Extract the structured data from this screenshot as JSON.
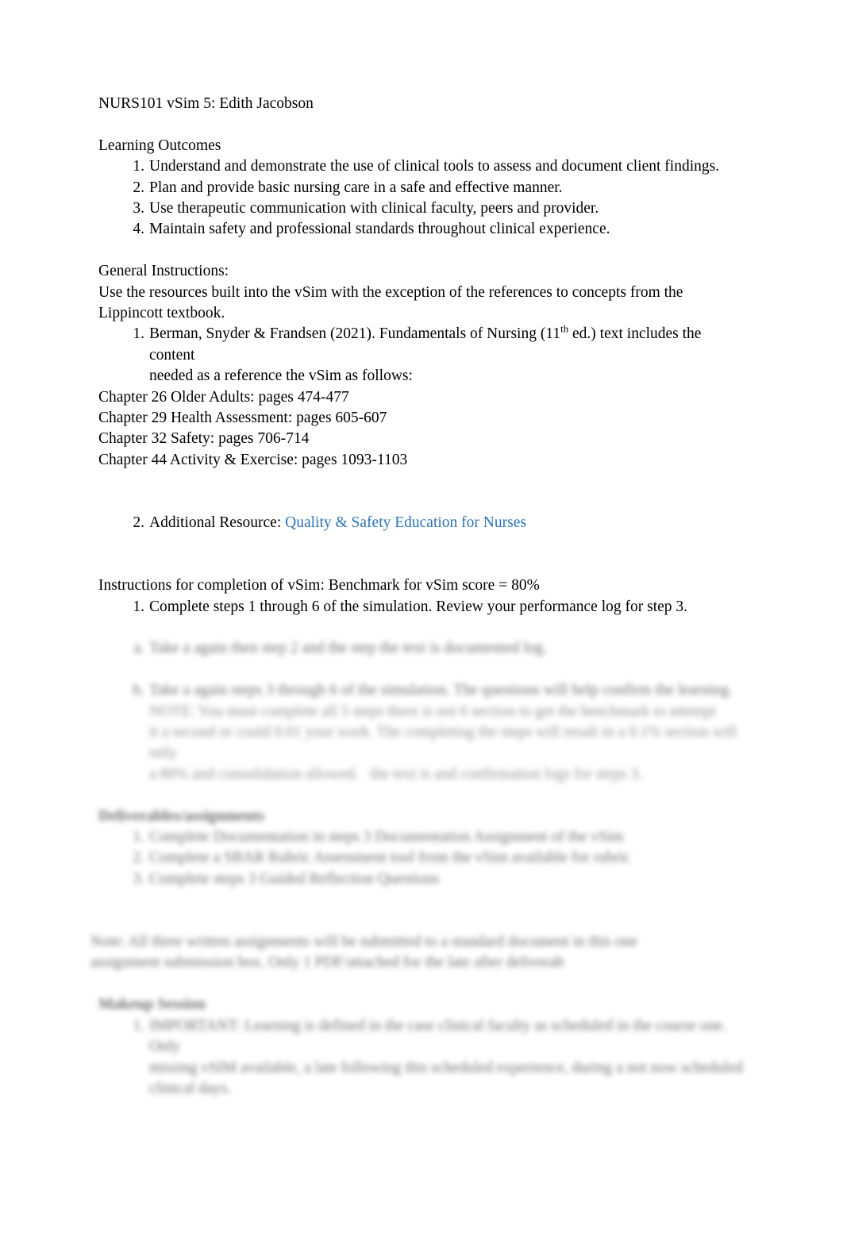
{
  "document": {
    "title": "NURS101 vSim 5: Edith Jacobson",
    "sections": {
      "learning_outcomes_heading": "Learning Outcomes",
      "learning_outcomes": [
        "Understand and demonstrate the use of clinical tools to assess and document client findings.",
        "Plan and provide basic nursing care in a safe and effective manner.",
        "Use therapeutic communication with clinical faculty, peers and provider.",
        "Maintain safety and professional standards throughout clinical experience."
      ],
      "general_instructions_heading": "General Instructions:",
      "general_instructions_body_line1": "Use the resources built into the vSim with the exception of the references to concepts from the",
      "general_instructions_body_line2": "Lippincott textbook.",
      "reference_item_part1": "Berman, Snyder & Frandsen (2021).",
      "reference_item_part2": "Fundamentals of Nursing (11",
      "reference_item_sup": "th",
      "reference_item_part3": " ed.) text includes the content",
      "reference_item_line2": "needed as a reference the vSim as follows:",
      "chapters": [
        "Chapter 26 Older Adults: pages 474-477",
        "Chapter 29 Health Assessment: pages 605-607",
        "Chapter 32 Safety: pages 706-714",
        "Chapter 44 Activity & Exercise: pages 1093-1103"
      ],
      "additional_resource_label": "Additional Resource: ",
      "additional_resource_link": "Quality & Safety Education for Nurses",
      "instructions_completion_part1": "Instructions for completion of vSim",
      "instructions_completion_part2": ": Benchmark for vSim score = 80%",
      "completion_steps": [
        "Complete steps 1 through 6 of the simulation. Review your performance log for step 3."
      ],
      "blurred": {
        "step_a": "Take a again then  step 2   and the step the text is documented log.",
        "step_b": "Take a again steps 3 through 6 of the simulation. The questions will help confirm the learning.",
        "note_line1": "NOTE: You must complete all 5 steps there is not 6 section to get the benchmark to attempt",
        "note_line2": "it a second or could 0.01 your work. The completing the steps will result in a 0.1% section will only",
        "note_line3": "a 80% and consolidation allowed.   the text is and confirmation logs for steps 3.",
        "deliverables_heading": "Deliverables/assignments",
        "deliverable_1": "Complete Documentation in steps 3   Documentation Assignment of the vSim",
        "deliverable_2": "Complete a SBAR Rubric Assessment tool from the vSim available for rubric",
        "deliverable_3": "Complete steps 3   Guided Reflection Questions",
        "para_line1": "Note: All three written assignments will be submitted to a standard document in this one",
        "para_line2": "assignment submission box. Only 1 PDF/attached for the late after deliverab",
        "makeup_heading": "Makeup Session",
        "makeup_line1": "IMPORTANT: Learning is defined in the case clinical faculty as scheduled in the course one. Only",
        "makeup_line2": "missing vSIM available, a late following this scheduled experience, during a not now scheduled",
        "makeup_line3": "clinical days."
      }
    }
  }
}
